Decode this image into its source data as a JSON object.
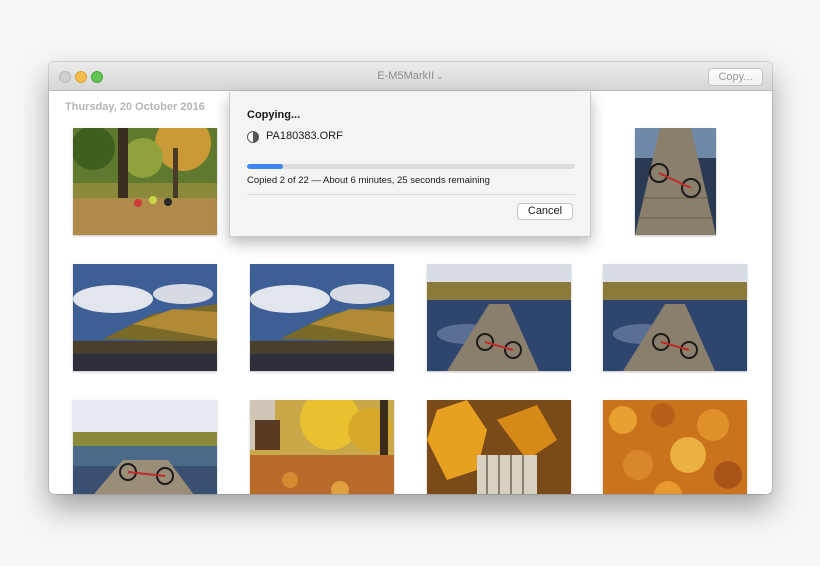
{
  "window": {
    "title": "E-M5MarkII",
    "title_chevron": "⌄",
    "copy_button": "Copy..."
  },
  "gallery": {
    "date_label": "Thursday, 20 October 2016",
    "thumbnails": [
      "forest-bikes-photo",
      "dock-bike-photo",
      "lake-hill-photo",
      "lake-hill-photo",
      "dock-bike-photo",
      "dock-bike-photo",
      "dock-bike-photo",
      "autumn-bench-photo",
      "maple-leaves-photo",
      "fallen-leaves-photo"
    ]
  },
  "dialog": {
    "title": "Copying...",
    "file_name": "PA180383.ORF",
    "progress": 0.11,
    "status": "Copied 2 of 22 — About 6 minutes, 25 seconds remaining",
    "cancel_button": "Cancel"
  },
  "colors": {
    "accent": "#3b86f0",
    "traffic_close": "#cfcfcf",
    "traffic_minimize": "#f5bd4f",
    "traffic_maximize": "#61c454"
  }
}
